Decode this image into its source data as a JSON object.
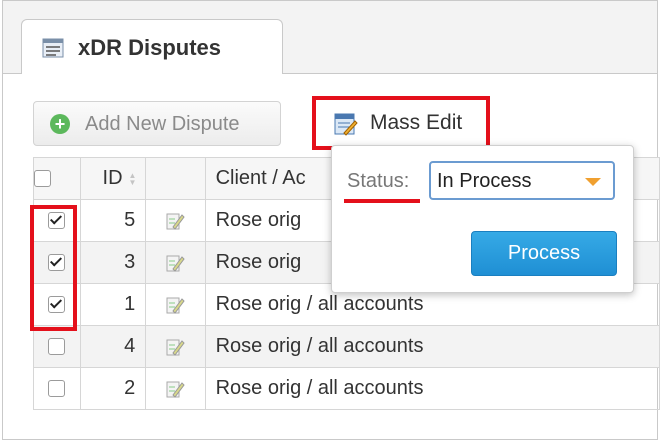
{
  "tab": {
    "title": "xDR Disputes"
  },
  "toolbar": {
    "add_label": "Add New Dispute",
    "mass_edit_label": "Mass Edit"
  },
  "table": {
    "headers": {
      "id": "ID",
      "client": "Client / Ac"
    },
    "rows": [
      {
        "id": "5",
        "client": "Rose orig",
        "checked": true
      },
      {
        "id": "3",
        "client": "Rose orig",
        "checked": true
      },
      {
        "id": "1",
        "client": "Rose orig / all accounts",
        "checked": true
      },
      {
        "id": "4",
        "client": "Rose orig / all accounts",
        "checked": false
      },
      {
        "id": "2",
        "client": "Rose orig / all accounts",
        "checked": false
      }
    ]
  },
  "popup": {
    "status_label": "Status:",
    "status_value": "In Process",
    "process_label": "Process"
  },
  "colors": {
    "highlight": "#e4101b",
    "primary": "#1f8fd4",
    "add_icon": "#5cb85c"
  }
}
